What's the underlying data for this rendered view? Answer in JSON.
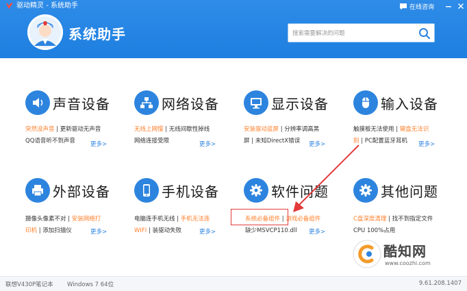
{
  "window": {
    "title": "驱动精灵 - 系统助手",
    "consult_label": "在线咨询"
  },
  "brand": {
    "title": "系统助手"
  },
  "search": {
    "placeholder": "搜索需要解决的问题"
  },
  "more_label": "更多>",
  "categories": [
    {
      "title": "声音设备",
      "icon": "speaker-icon",
      "line1": [
        {
          "text": "突然没声音",
          "style": "orange"
        },
        {
          "text": "更新驱动无声音",
          "style": "dark"
        }
      ],
      "line2": [
        {
          "text": "QQ语音听不到声音",
          "style": "dark"
        }
      ]
    },
    {
      "title": "网络设备",
      "icon": "network-icon",
      "line1": [
        {
          "text": "无线上网慢",
          "style": "orange"
        },
        {
          "text": "无线间歇性掉线",
          "style": "dark"
        }
      ],
      "line2": [
        {
          "text": "网络连接受限",
          "style": "dark"
        }
      ]
    },
    {
      "title": "显示设备",
      "icon": "monitor-icon",
      "line1": [
        {
          "text": "安装驱动蓝屏",
          "style": "orange"
        },
        {
          "text": "分辨率调高黑",
          "style": "dark"
        }
      ],
      "line2": [
        {
          "text": "屏",
          "style": "dark"
        },
        {
          "text": "未知DirectX错误",
          "style": "dark"
        }
      ]
    },
    {
      "title": "输入设备",
      "icon": "mouse-icon",
      "line1": [
        {
          "text": "触摸板无法使用",
          "style": "dark"
        },
        {
          "text": "键盘无法识",
          "style": "orange"
        }
      ],
      "line2": [
        {
          "text": "别",
          "style": "orange"
        },
        {
          "text": "PC配置蓝牙耳机",
          "style": "dark"
        }
      ]
    },
    {
      "title": "外部设备",
      "icon": "printer-icon",
      "line1": [
        {
          "text": "摄像头像素不对",
          "style": "dark"
        },
        {
          "text": "安装网络打",
          "style": "orange"
        }
      ],
      "line2": [
        {
          "text": "印机",
          "style": "orange"
        },
        {
          "text": "添加扫描仪",
          "style": "dark"
        }
      ]
    },
    {
      "title": "手机设备",
      "icon": "phone-icon",
      "line1": [
        {
          "text": "电脑连手机无线",
          "style": "dark"
        },
        {
          "text": "手机无法连",
          "style": "orange"
        }
      ],
      "line2": [
        {
          "text": "WIFI",
          "style": "orange"
        },
        {
          "text": "装驱动失败",
          "style": "dark"
        }
      ]
    },
    {
      "title": "软件问题",
      "icon": "gear-icon",
      "line1": [
        {
          "text": "系统必备组件",
          "style": "orange"
        },
        {
          "text": "游戏必备组件",
          "style": "orange"
        }
      ],
      "line2": [
        {
          "text": "缺少MSVCP110.dll",
          "style": "dark"
        }
      ]
    },
    {
      "title": "其他问题",
      "icon": "gear-icon",
      "line1": [
        {
          "text": "C盘深度清理",
          "style": "orange"
        },
        {
          "text": "找不到指定文件",
          "style": "dark"
        }
      ],
      "line2": [
        {
          "text": "CPU 100%占用",
          "style": "dark"
        }
      ]
    }
  ],
  "watermark": {
    "name": "酷知网",
    "url": "www.coozhi.com"
  },
  "status": {
    "model": "联想V430P笔记本",
    "os": "Windows 7 64位",
    "version": "9.61.208.1407"
  },
  "colors": {
    "header": "#1e7fe0",
    "accent": "#2d84de",
    "link_orange": "#ff7f2a",
    "annotation_red": "#e33a3a"
  }
}
